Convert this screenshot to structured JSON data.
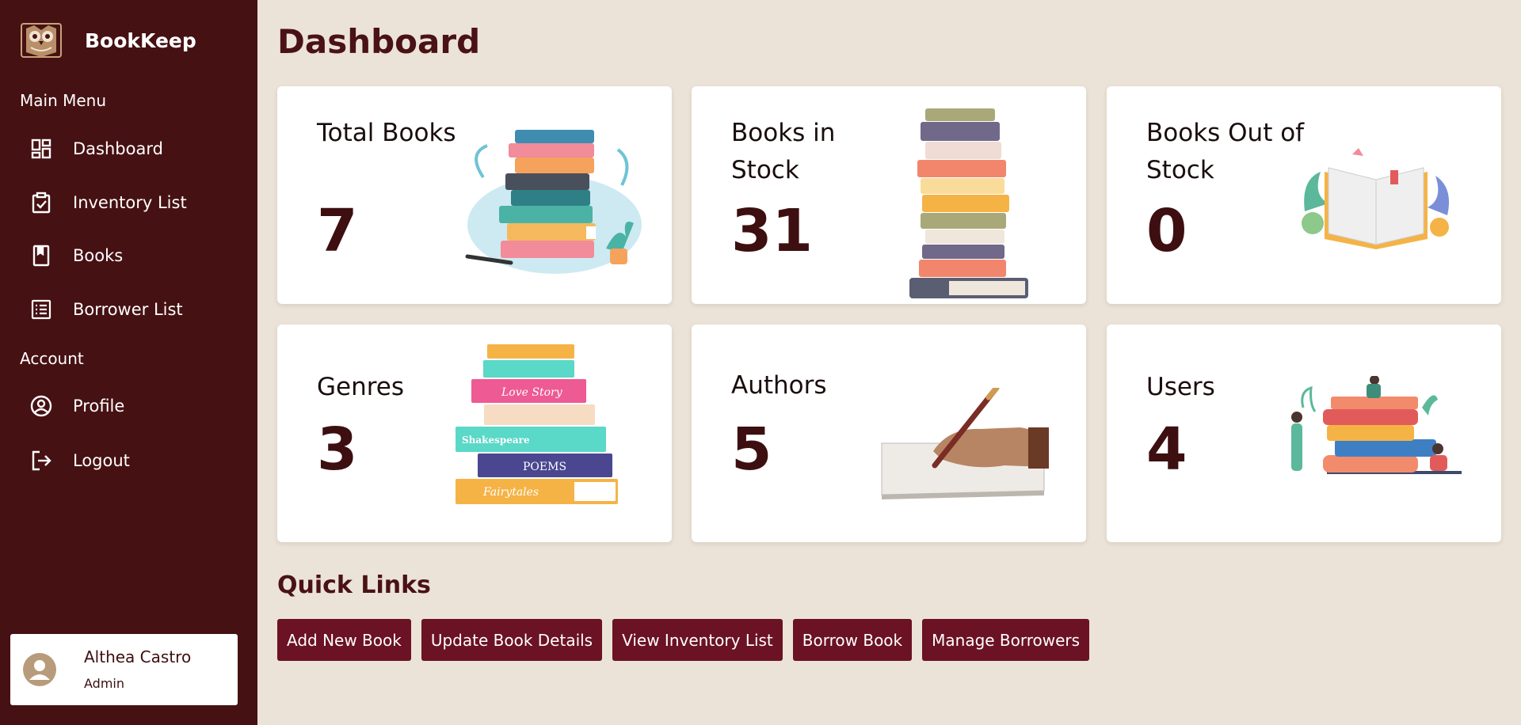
{
  "app": {
    "name": "BookKeep"
  },
  "sidebar": {
    "main_menu_label": "Main Menu",
    "account_label": "Account",
    "main_items": [
      {
        "label": "Dashboard",
        "icon": "dashboard-icon"
      },
      {
        "label": "Inventory List",
        "icon": "clipboard-check-icon"
      },
      {
        "label": "Books",
        "icon": "book-icon"
      },
      {
        "label": "Borrower List",
        "icon": "list-icon"
      }
    ],
    "account_items": [
      {
        "label": "Profile",
        "icon": "user-circle-icon"
      },
      {
        "label": "Logout",
        "icon": "logout-icon"
      }
    ]
  },
  "user": {
    "name": "Althea Castro",
    "role": "Admin"
  },
  "page": {
    "title": "Dashboard"
  },
  "stats": [
    {
      "label": "Total Books",
      "value": "7"
    },
    {
      "label": "Books in Stock",
      "value": "31"
    },
    {
      "label": "Books Out of Stock",
      "value": "0"
    },
    {
      "label": "Genres",
      "value": "3"
    },
    {
      "label": "Authors",
      "value": "5"
    },
    {
      "label": "Users",
      "value": "4"
    }
  ],
  "genre_spines": [
    "Love Story",
    "Shakespeare",
    "POEMS",
    "Fairytales"
  ],
  "quick_links": {
    "title": "Quick Links",
    "buttons": [
      "Add New Book",
      "Update Book Details",
      "View Inventory List",
      "Borrow Book",
      "Manage Borrowers"
    ]
  },
  "colors": {
    "sidebar": "#461113",
    "background": "#ebe3d7",
    "accent": "#6b1224",
    "text_dark": "#3d0f10"
  }
}
